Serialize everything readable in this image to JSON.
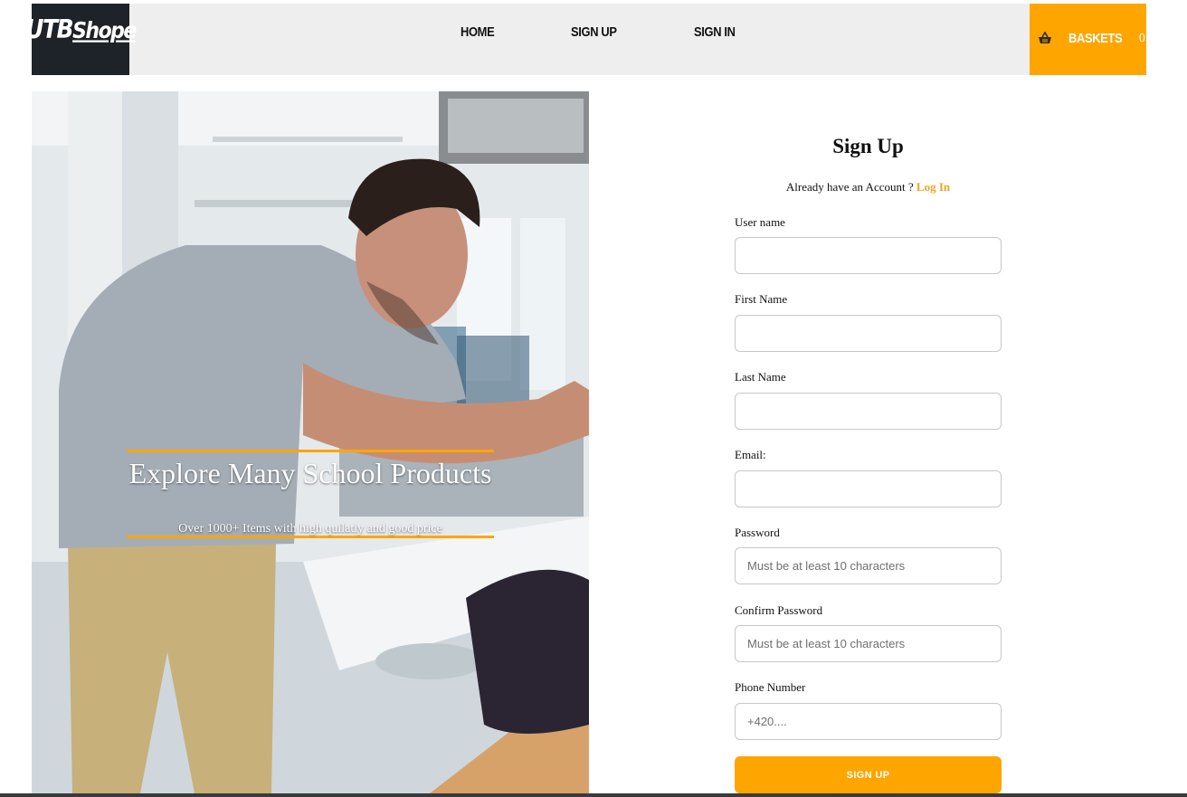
{
  "header": {
    "logo": {
      "main": "UTB",
      "swash": "Shope"
    },
    "nav": {
      "home": "HOME",
      "signup": "SIGN UP",
      "signin": "SIGN IN"
    },
    "basket": {
      "label": "BASKETS",
      "count": "0",
      "icon": "basket-icon"
    }
  },
  "hero": {
    "title": "Explore Many School Products",
    "subtitle": "Over 1000+ Items with high quilatiy and good price"
  },
  "form": {
    "title": "Sign Up",
    "account_prompt": "Already have an Account ?",
    "login_link": "Log In",
    "fields": {
      "username": {
        "label": "User name",
        "placeholder": "",
        "value": ""
      },
      "first_name": {
        "label": "First Name",
        "placeholder": "",
        "value": ""
      },
      "last_name": {
        "label": "Last Name",
        "placeholder": "",
        "value": ""
      },
      "email": {
        "label": "Email:",
        "placeholder": "",
        "value": ""
      },
      "password": {
        "label": "Password",
        "placeholder": "Must be at least 10 characters",
        "value": ""
      },
      "confirm_password": {
        "label": "Confirm Password",
        "placeholder": "Must be at least 10 characters",
        "value": ""
      },
      "phone": {
        "label": "Phone Number",
        "placeholder": "+420....",
        "value": ""
      }
    },
    "submit_label": "SIGN UP"
  },
  "colors": {
    "accent": "#ffa500",
    "logo_bg": "#1e2329",
    "header_bg": "#eeeeee",
    "link": "#f4a21c"
  }
}
